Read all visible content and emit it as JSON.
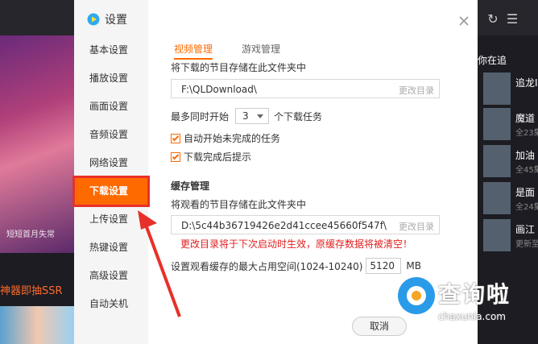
{
  "background": {
    "banner_caption": "短短首月失常",
    "promo_text": "神器即抽SSR",
    "right_panel_title": "你在追",
    "right_items": [
      {
        "name": "追龙I",
        "sub": ""
      },
      {
        "name": "魔道",
        "sub": "全23集"
      },
      {
        "name": "加油",
        "sub": "全45集"
      },
      {
        "name": "是面",
        "sub": "全24集"
      },
      {
        "name": "画江",
        "sub": "更新至"
      }
    ]
  },
  "dialog": {
    "title": "设置",
    "nav": [
      {
        "label": "基本设置",
        "active": false
      },
      {
        "label": "播放设置",
        "active": false
      },
      {
        "label": "画面设置",
        "active": false
      },
      {
        "label": "音频设置",
        "active": false
      },
      {
        "label": "网络设置",
        "active": false
      },
      {
        "label": "下载设置",
        "active": true
      },
      {
        "label": "上传设置",
        "active": false
      },
      {
        "label": "热键设置",
        "active": false
      },
      {
        "label": "高级设置",
        "active": false
      },
      {
        "label": "自动关机",
        "active": false
      }
    ],
    "tabs": [
      {
        "label": "视频管理",
        "active": true
      },
      {
        "label": "游戏管理",
        "active": false
      }
    ],
    "download_dir_label": "将下载的节目存储在此文件夹中",
    "download_dir": "F:\\QLDownload\\",
    "change_dir_label": "更改目录",
    "max_tasks_prefix": "最多同时开始",
    "max_tasks_value": "3",
    "max_tasks_suffix": "个下载任务",
    "auto_start_label": "自动开始未完成的任务",
    "auto_start_checked": true,
    "notify_label": "下载完成后提示",
    "notify_checked": true,
    "cache_section_title": "缓存管理",
    "cache_dir_label": "将观看的节目存储在此文件夹中",
    "cache_dir": "D:\\5c44b36719426e2d41ccee45660f547f\\",
    "cache_change_dir_label": "更改目录",
    "cache_warning": "更改目录将于下次启动时生效，原缓存数据将被清空！",
    "cache_size_label": "设置观看缓存的最大占用空间(1024-10240)",
    "cache_size_value": "5120",
    "cache_size_unit": "MB",
    "cancel_label": "取消"
  },
  "watermark": {
    "text": "查询啦",
    "sub": "chaxunla.com"
  },
  "colors": {
    "accent": "#ff6a00",
    "warning": "#e02020",
    "annotation": "#e8302a"
  }
}
